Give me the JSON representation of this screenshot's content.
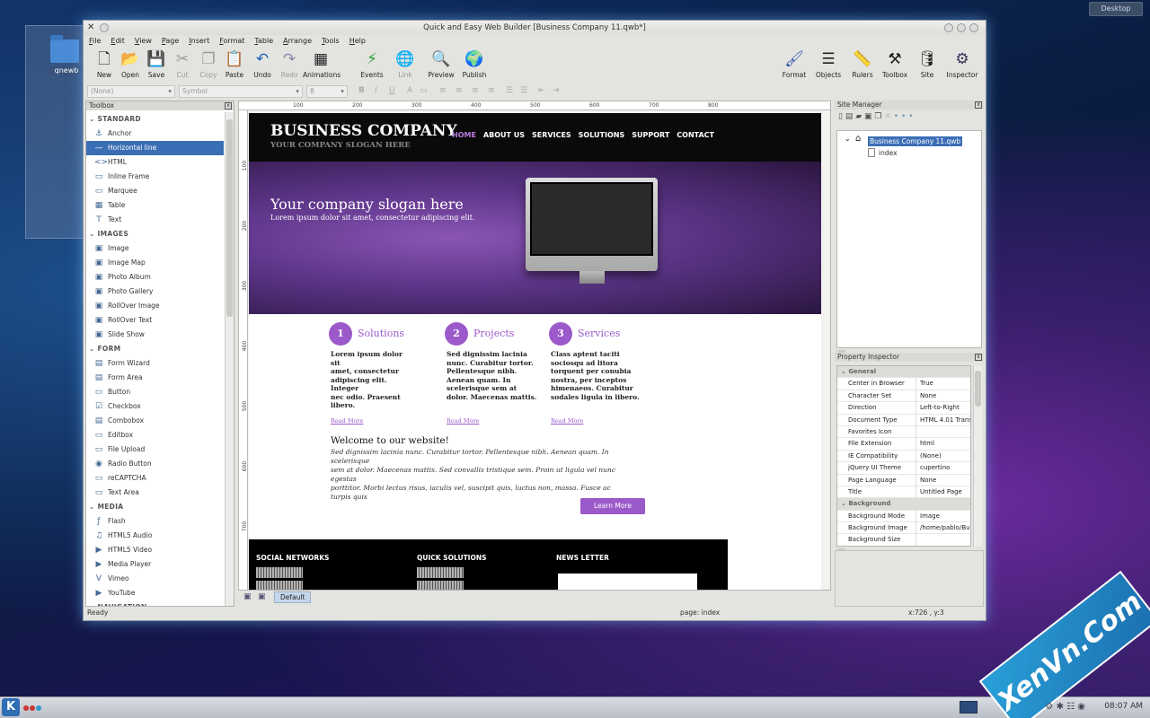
{
  "desktop": {
    "button_label": "Desktop",
    "icon_label": "qnewb"
  },
  "window": {
    "title": "Quick and Easy Web Builder [Business Company 11.qwb*]"
  },
  "menu": [
    "File",
    "Edit",
    "View",
    "Page",
    "Insert",
    "Format",
    "Table",
    "Arrange",
    "Tools",
    "Help"
  ],
  "toolbar": {
    "left": [
      "New",
      "Open",
      "Save",
      "Cut",
      "Copy",
      "Paste",
      "Undo",
      "Redo",
      "Animations",
      "Events",
      "Link",
      "Preview",
      "Publish"
    ],
    "right": [
      "Format",
      "Objects",
      "Rulers",
      "Toolbox",
      "Site",
      "Inspector"
    ]
  },
  "formatbar": {
    "font_select": "(None)",
    "font_name": "Symbol",
    "font_size": "8"
  },
  "toolbox": {
    "title": "Toolbox",
    "groups": [
      {
        "name": "STANDARD",
        "items": [
          "Anchor",
          "Horizontal line",
          "HTML",
          "Inline Frame",
          "Marquee",
          "Table",
          "Text"
        ]
      },
      {
        "name": "IMAGES",
        "items": [
          "Image",
          "Image Map",
          "Photo Album",
          "Photo Gallery",
          "RollOver Image",
          "RollOver Text",
          "Slide Show"
        ]
      },
      {
        "name": "FORM",
        "items": [
          "Form Wizard",
          "Form Area",
          "Button",
          "Checkbox",
          "Combobox",
          "Editbox",
          "File Upload",
          "Radio Button",
          "reCAPTCHA",
          "Text Area"
        ]
      },
      {
        "name": "MEDIA",
        "items": [
          "Flash",
          "HTML5 Audio",
          "HTML5 Video",
          "Media Player",
          "Vimeo",
          "YouTube"
        ]
      },
      {
        "name": "NAVIGATION",
        "items": []
      }
    ],
    "selected": "Horizontal line"
  },
  "ruler": {
    "h": [
      "100",
      "200",
      "300",
      "400",
      "500",
      "600",
      "700",
      "800"
    ],
    "v": [
      "100",
      "200",
      "300",
      "400",
      "500",
      "600",
      "700"
    ]
  },
  "page": {
    "logo": "BUSINESS COMPANY",
    "slogan": "YOUR COMPANY SLOGAN HERE",
    "nav": [
      "HOME",
      "ABOUT US",
      "SERVICES",
      "SOLUTIONS",
      "SUPPORT",
      "CONTACT"
    ],
    "hero_title": "Your company slogan here",
    "hero_sub": "Lorem ipsum dolor sit amet, consectetur adipiscing elit.",
    "columns": [
      {
        "num": "1",
        "title": "Solutions",
        "text": "Lorem ipsum dolor\nsit\namet, consectetur\nadipiscing elit.\nInteger\nnec odio. Praesent\nlibero.",
        "more": "Read More"
      },
      {
        "num": "2",
        "title": "Projects",
        "text": "Sed dignissim lacinia\nnunc. Curabitur tortor.\nPellentesque nibh.\nAenean quam. In\nscelerisque sem at\ndolor. Maecenas mattis.",
        "more": "Read More"
      },
      {
        "num": "3",
        "title": "Services",
        "text": "Class aptent taciti\nsociosqu ad litora\ntorquent per conubia\nnostra, per inceptos\nhimenaeos. Curabitur\nsodales ligula in libero.",
        "more": "Read More"
      }
    ],
    "welcome_title": "Welcome to our website!",
    "welcome_text": "Sed dignissim lacinia nunc. Curabitur tortor. Pellentesque nibh. Aenean quam. In\nscelerisque\nsem at dolor. Maecenas mattis. Sed convallis tristique sem. Proin ut ligula vel nunc\negestas\nporttitor. Morbi lectus risus, iaculis vel, suscipit quis, luctus non, massa. Fusce ac\nturpis quis",
    "learn_more": "Learn More",
    "footer": [
      "SOCIAL NETWORKS",
      "QUICK SOLUTIONS",
      "NEWS LETTER"
    ]
  },
  "canvas_tab": "Default",
  "status": {
    "left": "Ready",
    "page": "page: index",
    "coords": "x:726 , y:3"
  },
  "site_manager": {
    "title": "Site Manager",
    "root": "Business Company 11.qwb",
    "child": "index"
  },
  "property_inspector": {
    "title": "Property Inspector",
    "rows": [
      {
        "cat": "General"
      },
      {
        "k": "Center in Browser",
        "v": "True"
      },
      {
        "k": "Character Set",
        "v": "None"
      },
      {
        "k": "Direction",
        "v": "Left-to-Right"
      },
      {
        "k": "Document Type",
        "v": "HTML 4.01 Trans"
      },
      {
        "k": "Favorites Icon",
        "v": ""
      },
      {
        "k": "File Extension",
        "v": "html"
      },
      {
        "k": "IE Compatibility",
        "v": "(None)"
      },
      {
        "k": "jQuery UI Theme",
        "v": "cupertino"
      },
      {
        "k": "Page Language",
        "v": "None"
      },
      {
        "k": "Title",
        "v": "Untitled Page"
      },
      {
        "cat": "Background"
      },
      {
        "k": "Background Mode",
        "v": "Image"
      },
      {
        "k": "Background Image",
        "v": "/home/pablo/Bu"
      },
      {
        "k": "Background Size",
        "v": ""
      }
    ]
  },
  "taskbar": {
    "clock": "08:07 AM"
  },
  "watermark": "XenVn.Com"
}
